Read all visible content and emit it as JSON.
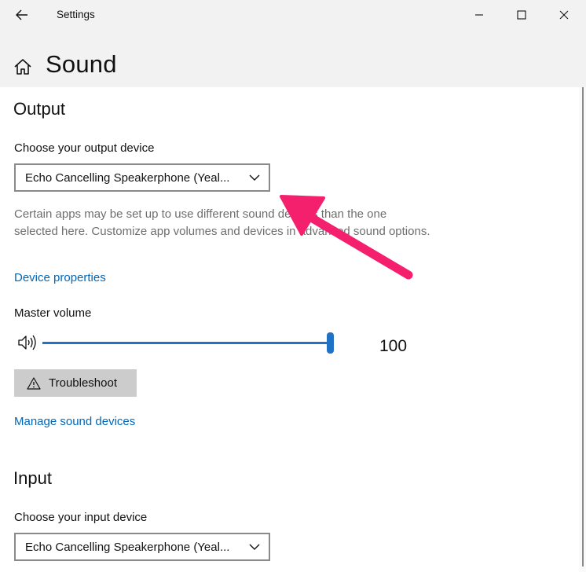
{
  "window": {
    "title": "Settings",
    "back_icon": "back-arrow-icon",
    "minimize_icon": "minimize-icon",
    "maximize_icon": "maximize-icon",
    "close_icon": "close-icon"
  },
  "header": {
    "home_icon": "home-icon",
    "title": "Sound"
  },
  "output": {
    "section_title": "Output",
    "device_label": "Choose your output device",
    "device_value": "Echo Cancelling Speakerphone (Yeal...",
    "help_text": "Certain apps may be set up to use different sound devices than the one selected here. Customize app volumes and devices in advanced sound options.",
    "device_properties_link": "Device properties",
    "master_volume_label": "Master volume",
    "volume_value": "100",
    "volume_level": 1.0,
    "troubleshoot_label": "Troubleshoot",
    "manage_link": "Manage sound devices"
  },
  "input": {
    "section_title": "Input",
    "device_label": "Choose your input device",
    "device_value": "Echo Cancelling Speakerphone (Yeal..."
  },
  "colors": {
    "accent": "#1f72c4",
    "link": "#0067b8",
    "annotation_arrow": "#f4206e",
    "chrome_bg": "#f2f2f2"
  }
}
